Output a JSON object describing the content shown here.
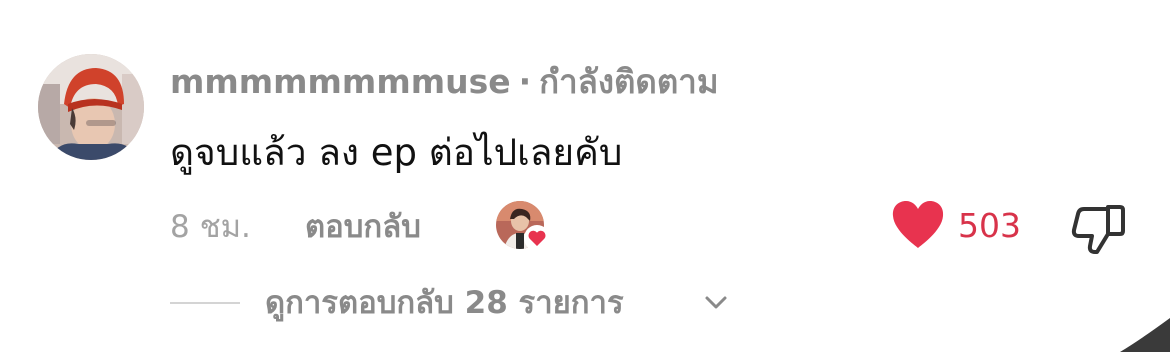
{
  "comment": {
    "username": "mmmmmmmmuse",
    "separator": "·",
    "follow_status": "กำลังติดตาม",
    "text": "ดูจบแล้ว ลง ep ต่อไปเลยคับ",
    "time": "8 ชม.",
    "reply_label": "ตอบกลับ",
    "like_count": "503",
    "like_color": "#e8334f",
    "creator_liked": true
  },
  "replies": {
    "view_label": "ดูการตอบกลับ 28 รายการ"
  },
  "icons": {
    "like": "heart-icon",
    "dislike": "thumbs-down-icon",
    "expand": "chevron-down-icon",
    "creator_like": "creator-heart-icon"
  }
}
